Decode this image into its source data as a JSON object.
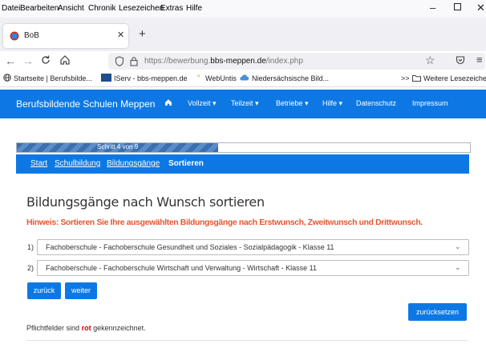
{
  "menubar": {
    "items": [
      "Datei",
      "Bearbeiten",
      "Ansicht",
      "Chronik",
      "Lesezeichen",
      "Extras",
      "Hilfe"
    ]
  },
  "browser": {
    "tab_title": "BoB",
    "url_prefix": "https://bewerbung.",
    "url_domain": "bbs-meppen.de",
    "url_suffix": "/index.php"
  },
  "bookmarks": {
    "items": [
      "Startseite | Berufsbilde...",
      "IServ - bbs-meppen.de",
      "WebUntis",
      "Niedersächsische Bild..."
    ],
    "overflow": ">>",
    "other": "Weitere Lesezeichen"
  },
  "site": {
    "brand": "Berufsbildende Schulen Meppen",
    "nav": [
      "Vollzeit",
      "Teilzeit",
      "Betriebe",
      "Hilfe",
      "Datenschutz",
      "Impressum"
    ],
    "progress_label": "Schritt 4 von 9",
    "progress_fraction": 0.444,
    "breadcrumbs": [
      "Start",
      "Schulbildung",
      "Bildungsgänge",
      "Sortieren"
    ]
  },
  "main": {
    "title": "Bildungsgänge nach Wunsch sortieren",
    "hint": "Hinweis: Sortieren Sie Ihre ausgewählten Bildungsgänge nach Erstwunsch, Zweitwunsch und Drittwunsch.",
    "selects": [
      {
        "num": "1)",
        "value": "Fachoberschule - Fachoberschule Gesundheit und Soziales - Sozialpädagogik - Klasse 11"
      },
      {
        "num": "2)",
        "value": "Fachoberschule - Fachoberschule Wirtschaft und Verwaltung - Wirtschaft - Klasse 11"
      }
    ],
    "back_label": "zurück",
    "next_label": "weiter",
    "reset_label": "zurücksetzen",
    "required_pre": "Pflichtfelder sind",
    "required_red": "rot",
    "required_post": "gekennzeichnet."
  },
  "colors": {
    "primary": "#0d78e4",
    "hint": "#e4572e",
    "required": "#d00000"
  }
}
